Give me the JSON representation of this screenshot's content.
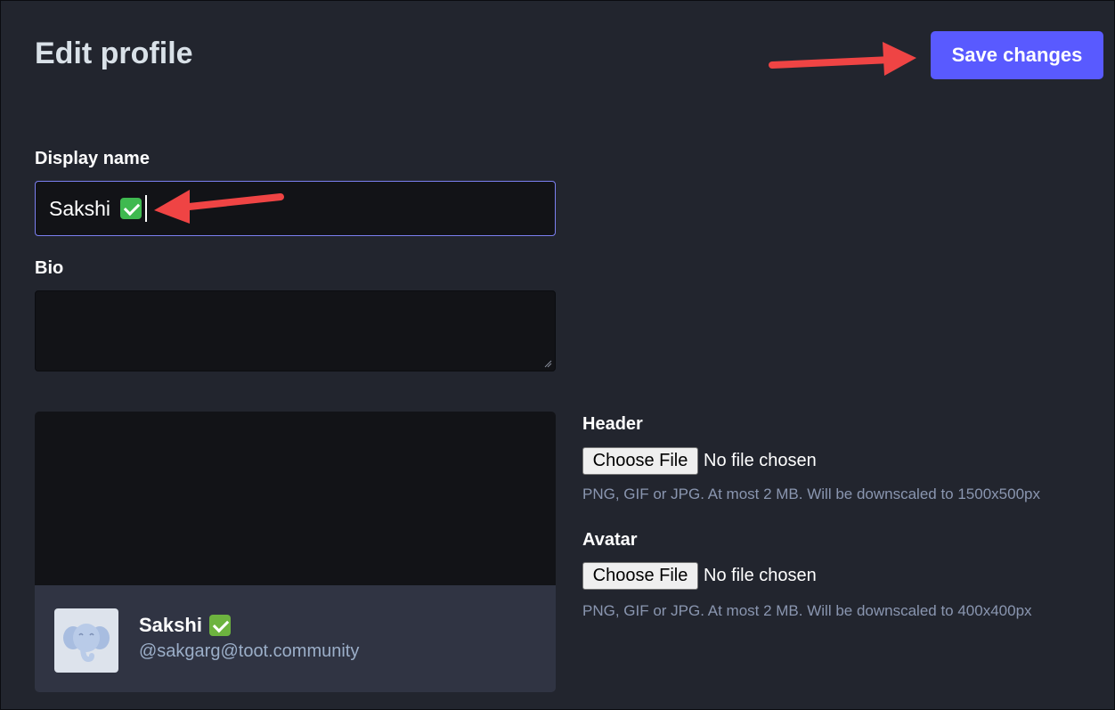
{
  "page": {
    "title": "Edit profile"
  },
  "toolbar": {
    "save_label": "Save changes"
  },
  "form": {
    "display_name": {
      "label": "Display name",
      "value": "Sakshi"
    },
    "bio": {
      "label": "Bio",
      "value": ""
    },
    "header": {
      "label": "Header",
      "button_label": "Choose File",
      "status": "No file chosen",
      "hint": "PNG, GIF or JPG. At most 2 MB. Will be downscaled to 1500x500px"
    },
    "avatar": {
      "label": "Avatar",
      "button_label": "Choose File",
      "status": "No file chosen",
      "hint": "PNG, GIF or JPG. At most 2 MB. Will be downscaled to 400x400px"
    }
  },
  "preview": {
    "name": "Sakshi",
    "handle": "@sakgarg@toot.community",
    "avatar_icon": "mastodon-elephant-icon"
  },
  "colors": {
    "background": "#22252e",
    "accent": "#595aff",
    "input_background": "#121317",
    "annotation_arrow": "#ef4444",
    "check_emoji": "#3fb950"
  }
}
